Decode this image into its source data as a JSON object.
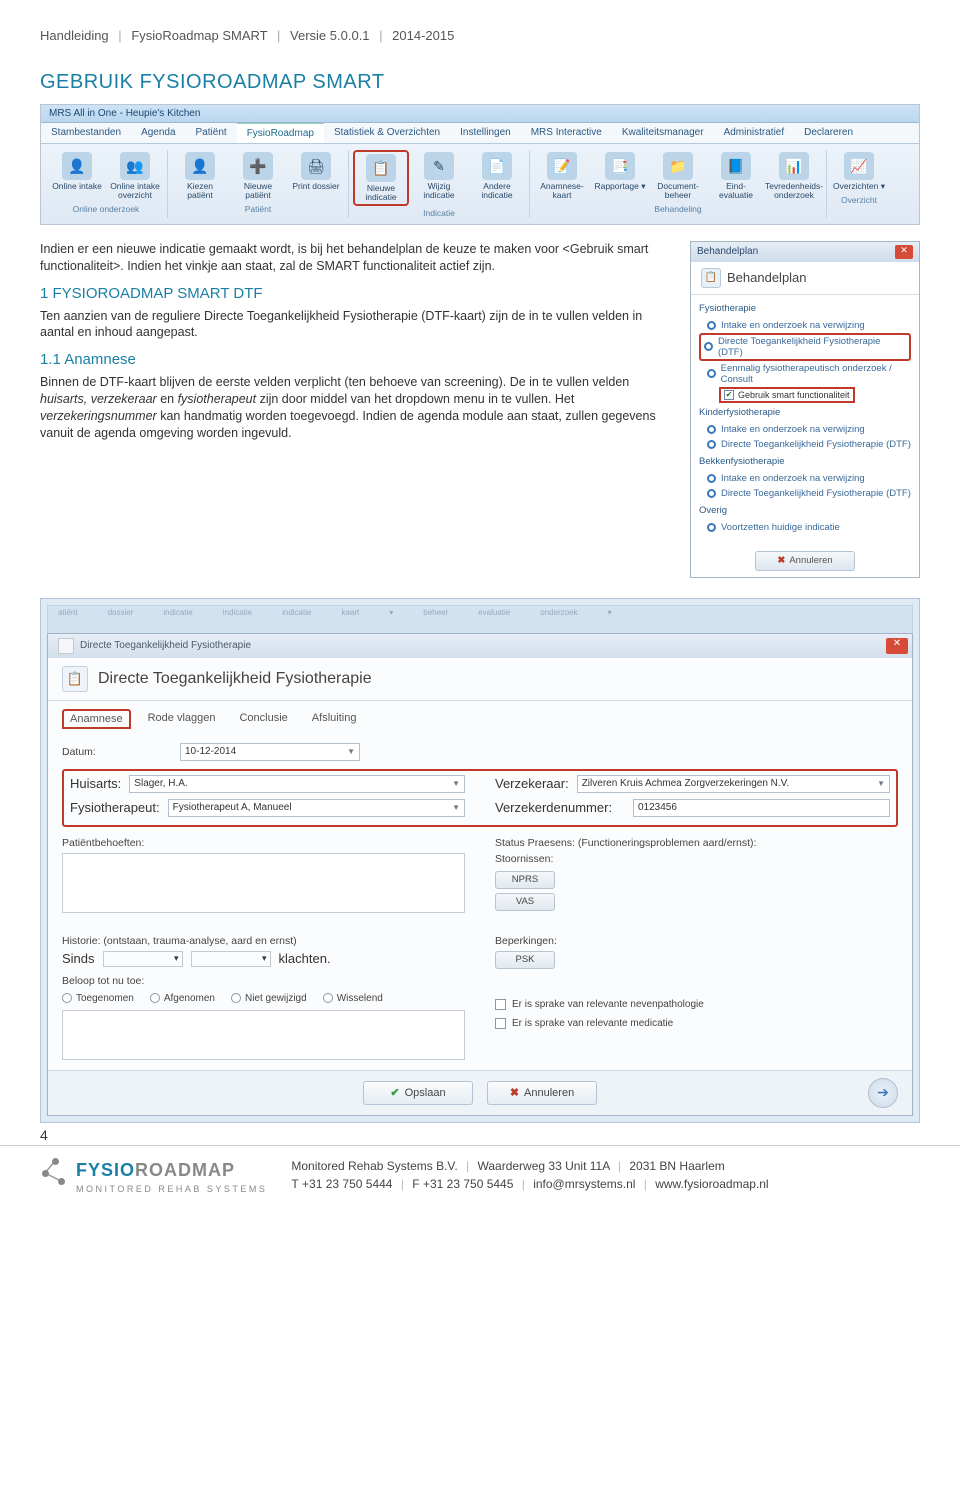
{
  "doc_header": {
    "manual": "Handleiding",
    "product": "FysioRoadmap SMART",
    "version_label": "Versie 5.0.0.1",
    "daterange": "2014-2015"
  },
  "title": "GEBRUIK FYSIOROADMAP SMART",
  "intro_p1": "Indien er een nieuwe indicatie gemaakt wordt, is bij het behandelplan de keuze te maken voor <Gebruik smart functionaliteit>. Indien het vinkje aan staat, zal de SMART functionaliteit actief zijn.",
  "section1_title": "1   FYSIOROADMAP SMART DTF",
  "section1_p": "Ten aanzien van de reguliere Directe Toegankelijkheid Fysiotherapie (DTF-kaart) zijn de in te vullen velden in aantal en inhoud aangepast.",
  "section11_title": "1.1 Anamnese",
  "section11_p": "Binnen de DTF-kaart blijven de eerste velden verplicht (ten behoeve van screening). De in te vullen velden huisarts, verzekeraar en fysiotherapeut zijn door middel van het dropdown menu in te vullen. Het verzekeringsnummer kan handmatig worden toegevoegd. Indien de agenda module aan staat, zullen gegevens vanuit de agenda omgeving worden ingevuld.",
  "ribbon": {
    "app_title": "MRS All in One - Heupie's Kitchen",
    "tabs": [
      "Stambestanden",
      "Agenda",
      "Patiënt",
      "FysioRoadmap",
      "Statistiek & Overzichten",
      "Instellingen",
      "MRS Interactive",
      "Kwaliteitsmanager",
      "Administratief",
      "Declareren"
    ],
    "active_tab_index": 3,
    "groups": [
      {
        "label": "Online onderzoek",
        "items": [
          {
            "label": "Online intake",
            "icon": "👤"
          },
          {
            "label": "Online intake overzicht",
            "icon": "👥"
          }
        ]
      },
      {
        "label": "Patiënt",
        "items": [
          {
            "label": "Kiezen patiënt",
            "icon": "👤"
          },
          {
            "label": "Nieuwe patiënt",
            "icon": "➕"
          },
          {
            "label": "Print dossier",
            "icon": "🖨"
          }
        ]
      },
      {
        "label": "Indicatie",
        "items": [
          {
            "label": "Nieuwe indicatie",
            "icon": "📋",
            "hl": true
          },
          {
            "label": "Wijzig indicatie",
            "icon": "✎"
          },
          {
            "label": "Andere indicatie",
            "icon": "📄"
          }
        ]
      },
      {
        "label": "Behandeling",
        "items": [
          {
            "label": "Anamnese- kaart",
            "icon": "📝"
          },
          {
            "label": "Rapportage ▾",
            "icon": "📑"
          },
          {
            "label": "Document- beheer",
            "icon": "📁"
          },
          {
            "label": "Eind- evaluatie",
            "icon": "📘"
          },
          {
            "label": "Tevredenheids- onderzoek",
            "icon": "📊"
          }
        ]
      },
      {
        "label": "Overzicht",
        "items": [
          {
            "label": "Overzichten ▾",
            "icon": "📈"
          }
        ]
      }
    ]
  },
  "side_panel": {
    "window_title": "Behandelplan",
    "header": "Behandelplan",
    "groups": [
      {
        "label": "Fysiotherapie",
        "options": [
          {
            "text": "Intake en onderzoek na verwijzing"
          },
          {
            "text": "Directe Toegankelijkheid Fysiotherapie (DTF)",
            "hl": true
          },
          {
            "text": "Eenmalig fysiotherapeutisch onderzoek / Consult"
          }
        ],
        "checkbox": "Gebruik smart functionaliteit"
      },
      {
        "label": "Kinderfysiotherapie",
        "options": [
          {
            "text": "Intake en onderzoek na verwijzing"
          },
          {
            "text": "Directe Toegankelijkheid Fysiotherapie (DTF)"
          }
        ]
      },
      {
        "label": "Bekkenfysiotherapie",
        "options": [
          {
            "text": "Intake en onderzoek na verwijzing"
          },
          {
            "text": "Directe Toegankelijkheid Fysiotherapie (DTF)"
          }
        ]
      },
      {
        "label": "Overig",
        "options": [
          {
            "text": "Voortzetten huidige indicatie"
          }
        ]
      }
    ],
    "cancel": "Annuleren"
  },
  "dtf": {
    "window_title": "Directe Toegankelijkheid Fysiotherapie",
    "tabs": [
      "Anamnese",
      "Rode vlaggen",
      "Conclusie",
      "Afsluiting"
    ],
    "datum_label": "Datum:",
    "datum_value": "10-12-2014",
    "huisarts_label": "Huisarts:",
    "huisarts_value": "Slager, H.A.",
    "verzekeraar_label": "Verzekeraar:",
    "verzekeraar_value": "Zilveren Kruis Achmea Zorgverzekeringen N.V.",
    "fysio_label": "Fysiotherapeut:",
    "fysio_value": "Fysiotherapeut A, Manueel",
    "verzeknr_label": "Verzekerdenummer:",
    "verzeknr_value": "0123456",
    "patientbehoeften": "Patiëntbehoeften:",
    "status_praesens": "Status Praesens: (Functioneringsproblemen aard/ernst):",
    "stoornissen": "Stoornissen:",
    "chips": [
      "NPRS",
      "VAS"
    ],
    "historie": "Historie: (ontstaan, trauma-analyse, aard en ernst)",
    "sinds": "Sinds",
    "klachten": "klachten.",
    "beloop": "Beloop tot nu toe:",
    "beloop_opts": [
      "Toegenomen",
      "Afgenomen",
      "Niet gewijzigd",
      "Wisselend"
    ],
    "beperkingen": "Beperkingen:",
    "psk": "PSK",
    "neven": "Er is sprake van relevante nevenpathologie",
    "medic": "Er is sprake van relevante medicatie",
    "opslaan": "Opslaan",
    "annuleren": "Annuleren"
  },
  "page_number": "4",
  "footer": {
    "brand_a": "FYSIO",
    "brand_b": "ROADMAP",
    "tag": "MONITORED REHAB SYSTEMS",
    "company": "Monitored Rehab Systems B.V.",
    "address": "Waarderweg 33 Unit 11A",
    "postal": "2031 BN Haarlem",
    "tel_label": "T",
    "tel": "+31 23 750 5444",
    "fax_label": "F",
    "fax": "+31 23 750 5445",
    "email": "info@mrsystems.nl",
    "site": "www.fysioroadmap.nl"
  }
}
